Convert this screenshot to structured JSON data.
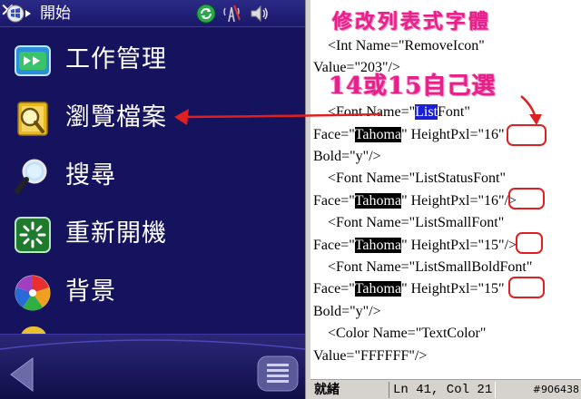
{
  "phone": {
    "title": "開始",
    "tray_icons": [
      "sync-icon",
      "signal-icon",
      "volume-icon"
    ],
    "close_label": "✕",
    "menu": [
      {
        "label": "工作管理",
        "icon": "task-manager-icon"
      },
      {
        "label": "瀏覽檔案",
        "icon": "file-explorer-icon"
      },
      {
        "label": "搜尋",
        "icon": "search-icon"
      },
      {
        "label": "重新開機",
        "icon": "restart-icon"
      },
      {
        "label": "背景",
        "icon": "background-icon"
      }
    ]
  },
  "annotations": {
    "modify_list_font": "修改列表式字體",
    "choose_size": "14或15自己選"
  },
  "editor": {
    "lines": [
      {
        "parts": [
          {
            "t": "    <Int Name=\"RemoveIcon\""
          }
        ]
      },
      {
        "parts": [
          {
            "t": "Value=\"203\"/>"
          }
        ]
      },
      {
        "parts": [
          {
            "t": ""
          }
        ]
      },
      {
        "parts": [
          {
            "t": "    <Font Name=\""
          },
          {
            "t": "List",
            "hl": "blue"
          },
          {
            "t": "Font\""
          }
        ]
      },
      {
        "parts": [
          {
            "t": "Face=\""
          },
          {
            "t": "Tahoma",
            "hl": "black"
          },
          {
            "t": "\" HeightPxl=\"16\""
          }
        ]
      },
      {
        "parts": [
          {
            "t": "Bold=\"y\"/>"
          }
        ]
      },
      {
        "parts": [
          {
            "t": "    <Font Name=\"ListStatusFont\""
          }
        ]
      },
      {
        "parts": [
          {
            "t": "Face=\""
          },
          {
            "t": "Tahoma",
            "hl": "black"
          },
          {
            "t": "\" HeightPxl=\"16\"/>"
          }
        ]
      },
      {
        "parts": [
          {
            "t": "    <Font Name=\"ListSmallFont\""
          }
        ]
      },
      {
        "parts": [
          {
            "t": "Face=\""
          },
          {
            "t": "Tahoma",
            "hl": "black"
          },
          {
            "t": "\" HeightPxl=\"15\"/>"
          }
        ]
      },
      {
        "parts": [
          {
            "t": "    <Font Name=\"ListSmallBoldFont\""
          }
        ]
      },
      {
        "parts": [
          {
            "t": "Face=\""
          },
          {
            "t": "Tahoma",
            "hl": "black"
          },
          {
            "t": "\" HeightPxl=\"15\""
          }
        ]
      },
      {
        "parts": [
          {
            "t": "Bold=\"y\"/>"
          }
        ]
      },
      {
        "parts": [
          {
            "t": "    <Color Name=\"TextColor\""
          }
        ]
      },
      {
        "parts": [
          {
            "t": "Value=\"FFFFFF\"/>"
          }
        ]
      }
    ]
  },
  "statusbar": {
    "ready": "就緒",
    "position": "Ln 41, Col 21",
    "watermark": "#906438"
  },
  "colors": {
    "phone_bg": "#15125e",
    "annotation_pink": "#e6208a",
    "arrow_red": "#e02020"
  }
}
